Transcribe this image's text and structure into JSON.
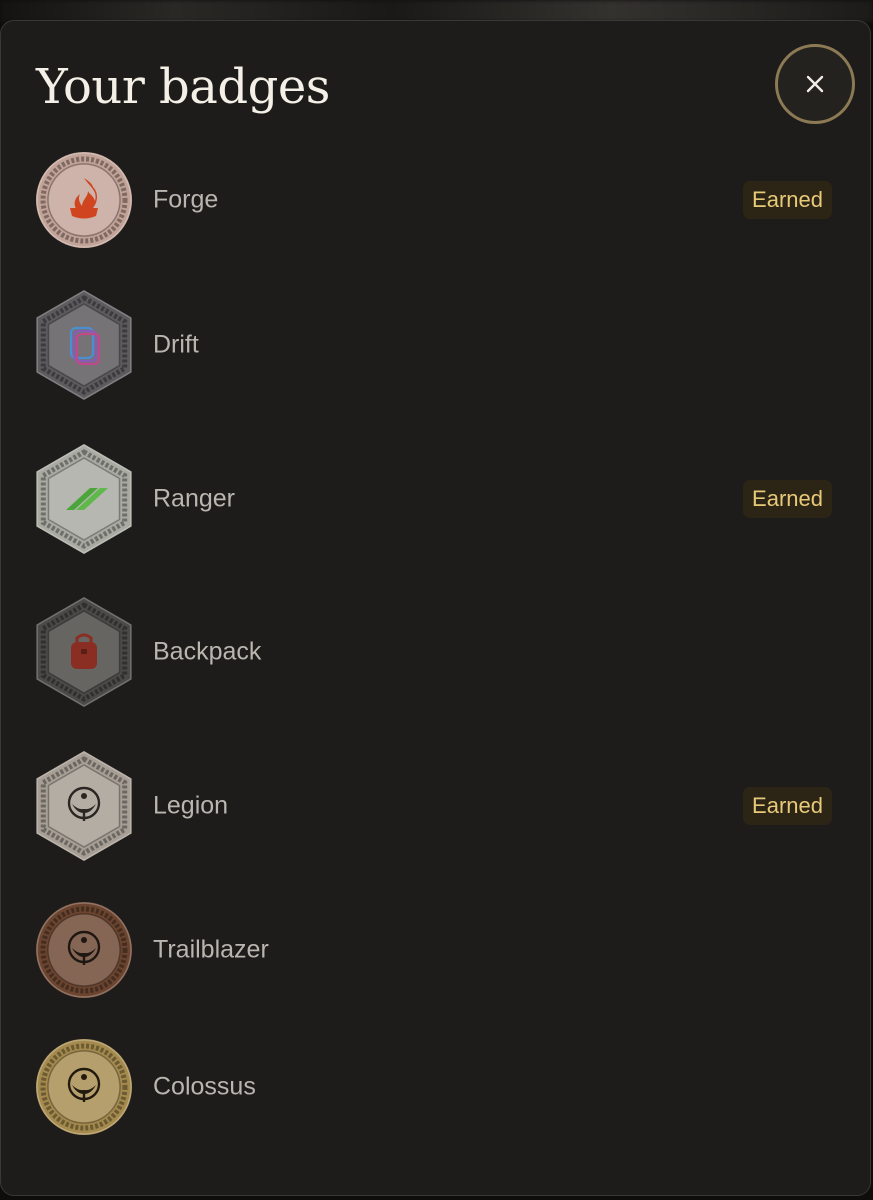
{
  "dialog": {
    "title": "Your badges",
    "close_icon": "close-icon"
  },
  "badges": [
    {
      "name": "Forge",
      "status": "Earned",
      "earned": true,
      "frame": "circle",
      "metal": "#c2a398",
      "emblem": "flame-icon",
      "accent": "#d0451f"
    },
    {
      "name": "Drift",
      "status": "",
      "earned": false,
      "frame": "hexagon",
      "metal": "#5d5b5e",
      "emblem": "layered-frames-icon",
      "accent": "#8a5ab8"
    },
    {
      "name": "Ranger",
      "status": "Earned",
      "earned": true,
      "frame": "hexagon",
      "metal": "#a9aba3",
      "emblem": "double-slash-icon",
      "accent": "#4ca53a"
    },
    {
      "name": "Backpack",
      "status": "",
      "earned": false,
      "frame": "hexagon",
      "metal": "#4c4a47",
      "emblem": "backpack-icon",
      "accent": "#8a2d23"
    },
    {
      "name": "Legion",
      "status": "Earned",
      "earned": true,
      "frame": "hexagon",
      "metal": "#a79f95",
      "emblem": "ring-figure-icon",
      "accent": "#2a2622"
    },
    {
      "name": "Trailblazer",
      "status": "",
      "earned": false,
      "frame": "circle",
      "metal": "#6b4530",
      "emblem": "ring-figure-icon",
      "accent": "#1e1712"
    },
    {
      "name": "Colossus",
      "status": "",
      "earned": false,
      "frame": "circle",
      "metal": "#a58a4e",
      "emblem": "ring-figure-icon",
      "accent": "#231a0f"
    }
  ]
}
